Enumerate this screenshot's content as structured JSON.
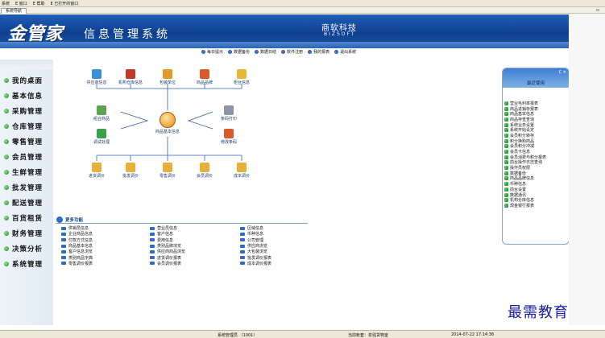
{
  "menubar": {
    "items": [
      "系统",
      "E 窗口",
      "E 帮助",
      "E 已打开的窗口"
    ]
  },
  "tab": {
    "label": "系统导航"
  },
  "header": {
    "logo": "金管家",
    "title": "信息管理系统",
    "company_cn": "商软科技",
    "company_en": "BIZSOFT"
  },
  "toolbar": {
    "items": [
      "每日提示",
      "数据备份",
      "数据日结",
      "软件注册",
      "我的报表",
      "退出系统"
    ]
  },
  "sidebar": {
    "items": [
      "我的桌面",
      "基本信息",
      "采购管理",
      "仓库管理",
      "零售管理",
      "会员管理",
      "生鲜管理",
      "批发管理",
      "配送管理",
      "百货租赁",
      "财务管理",
      "决策分析",
      "系统管理"
    ]
  },
  "flow": {
    "top": [
      "供应商信息",
      "机构仓库信息",
      "包装单位",
      "商品品牌",
      "柜台信息"
    ],
    "left": [
      "组合商品",
      "调试处理"
    ],
    "hub": "商品基本信息",
    "right": [
      "条码打印",
      "修改条码"
    ],
    "bottom": [
      "进货调价",
      "批发调价",
      "零售调价",
      "会员调价",
      "成本调价"
    ]
  },
  "more": {
    "title": "更多功能",
    "col1": [
      "供销员信息",
      "企业商品信息",
      "付款方式信息",
      "商品基本信息",
      "客户信息浏览",
      "类别商品字典",
      "零售调价报表"
    ],
    "col2": [
      "营业员信息",
      "客户信息",
      "费用信息",
      "类别品牌浏览",
      "供应商商品浏览",
      "进货调价报表",
      "会员调价报表"
    ],
    "col3": [
      "区域信息",
      "币种信息",
      "公司管理",
      "供应商浏览",
      "大包装浏览",
      "批发调价报表",
      "成本调价报表"
    ]
  },
  "panel": {
    "ctl": "C ✕",
    "title": "最近使用",
    "items": [
      "营业毛利率报表",
      "商品进销存报表",
      "商品基本信息",
      "商品存查查询",
      "系统业务设置",
      "系统开始设定",
      "会员积分转存",
      "积分换购商品",
      "会员积分冲减",
      "会员卡信息",
      "会员消费与积分报表",
      "前台操作日志查询",
      "操作员权限",
      "数据备份",
      "商品品牌信息",
      "币种信息",
      "前台设置",
      "数据通讯",
      "机构仓库信息",
      "现金银行报表"
    ]
  },
  "statusbar": {
    "user": "系统管理员 （1001）",
    "org": "当前帐套：泉强货物室",
    "time": "2014-07-22 17:14:38"
  },
  "watermark": "最需教育",
  "colors": {
    "header": "#1f5fb8",
    "sidebar_bg": "#e8eff6",
    "accent_green": "#1f8a1f",
    "link_blue": "#1a3a6a"
  }
}
